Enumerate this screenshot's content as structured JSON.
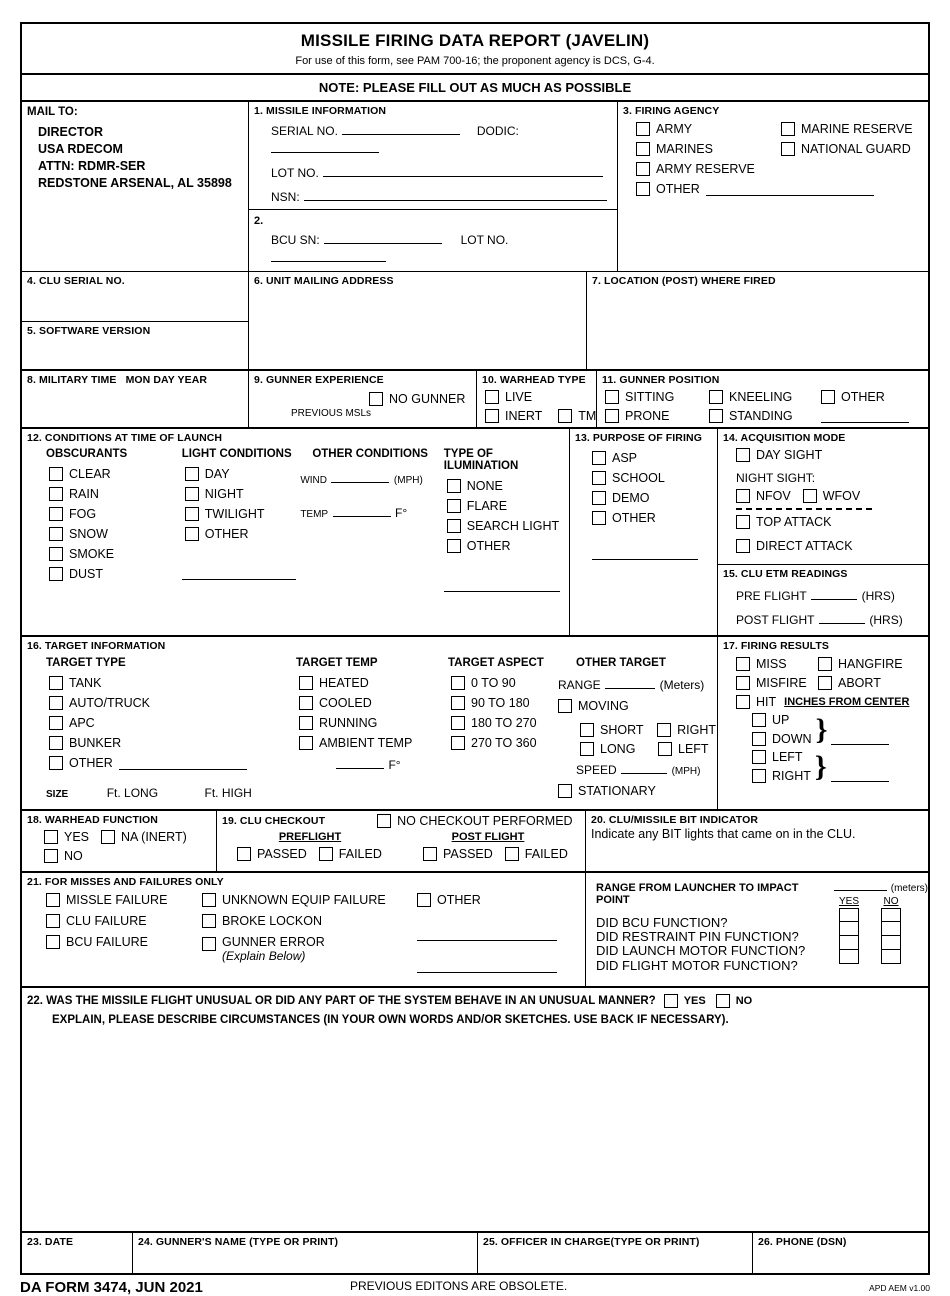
{
  "header": {
    "title": "MISSILE FIRING DATA REPORT (JAVELIN)",
    "subtitle": "For use of this form, see PAM 700-16; the proponent agency is DCS, G-4.",
    "note": "NOTE: PLEASE FILL OUT AS MUCH AS POSSIBLE"
  },
  "mail_to": {
    "label": "MAIL TO:",
    "lines": [
      "DIRECTOR",
      "USA RDECOM",
      "ATTN: RDMR-SER",
      "REDSTONE ARSENAL, AL 35898"
    ]
  },
  "s1": {
    "label": "1. MISSILE INFORMATION",
    "serial_no": "SERIAL NO.",
    "dodic": "DODIC:",
    "lot_no": "LOT NO.",
    "nsn": "NSN:"
  },
  "s2": {
    "num": "2.",
    "bcu_sn": "BCU SN:",
    "lot_no": "LOT NO."
  },
  "s3": {
    "label": "3. FIRING AGENCY",
    "options": [
      "ARMY",
      "MARINES",
      "ARMY RESERVE",
      "OTHER",
      "MARINE RESERVE",
      "NATIONAL GUARD"
    ]
  },
  "s4": {
    "label": "4. CLU SERIAL NO."
  },
  "s5": {
    "label": "5. SOFTWARE VERSION"
  },
  "s6": {
    "label": "6. UNIT MAILING ADDRESS"
  },
  "s7": {
    "label": "7. LOCATION (POST) WHERE FIRED"
  },
  "s8": {
    "label": "8. MILITARY TIME",
    "label2": "MON  DAY  YEAR"
  },
  "s9": {
    "label": "9. GUNNER EXPERIENCE",
    "no_gunner": "NO  GUNNER",
    "previous": "PREVIOUS MSLs"
  },
  "s10": {
    "label": "10. WARHEAD TYPE",
    "live": "LIVE",
    "inert": "INERT",
    "tm": "TM"
  },
  "s11": {
    "label": "11. GUNNER POSITION",
    "sitting": "SITTING",
    "kneeling": "KNEELING",
    "other": "OTHER",
    "prone": "PRONE",
    "standing": "STANDING"
  },
  "s12": {
    "label": "12. CONDITIONS AT TIME OF LAUNCH",
    "obscurants_hd": "OBSCURANTS",
    "obscurants": [
      "CLEAR",
      "RAIN",
      "FOG",
      "SNOW",
      "SMOKE",
      "DUST"
    ],
    "light_hd": "LIGHT CONDITIONS",
    "light": [
      "DAY",
      "NIGHT",
      "TWILIGHT",
      "OTHER"
    ],
    "other_hd": "OTHER CONDITIONS",
    "wind": "WIND",
    "mph": "(MPH)",
    "temp": "TEMP",
    "fdeg": "F°",
    "illum_hd": "TYPE OF ILUMINATION",
    "illum": [
      "NONE",
      "FLARE",
      "SEARCH LIGHT",
      "OTHER"
    ]
  },
  "s13": {
    "label": "13. PURPOSE OF FIRING",
    "options": [
      "ASP",
      "SCHOOL",
      "DEMO",
      "OTHER"
    ]
  },
  "s14": {
    "label": "14. ACQUISITION MODE",
    "day_sight": "DAY SIGHT",
    "night_sight": "NIGHT SIGHT:",
    "nfov": "NFOV",
    "wfov": "WFOV",
    "top_attack": "TOP ATTACK",
    "direct_attack": "DIRECT ATTACK"
  },
  "s15": {
    "label": "15. CLU ETM READINGS",
    "pre": "PRE FLIGHT",
    "post": "POST FLIGHT",
    "hrs": "(HRS)"
  },
  "s16": {
    "label": "16. TARGET INFORMATION",
    "type_hd": "TARGET TYPE",
    "types": [
      "TANK",
      "AUTO/TRUCK",
      "APC",
      "BUNKER",
      "OTHER"
    ],
    "temp_hd": "TARGET TEMP",
    "temps": [
      "HEATED",
      "COOLED",
      "RUNNING",
      "AMBIENT TEMP"
    ],
    "fdeg": "F°",
    "aspect_hd": "TARGET ASPECT",
    "aspects": [
      "0 TO 90",
      "90 TO 180",
      "180 TO 270",
      "270 TO 360"
    ],
    "other_hd": "OTHER TARGET",
    "range": "RANGE",
    "meters": "(Meters)",
    "moving": "MOVING",
    "short": "SHORT",
    "right": "RIGHT",
    "long": "LONG",
    "left": "LEFT",
    "speed": "SPEED",
    "mph": "(MPH)",
    "stationary": "STATIONARY",
    "size": "SIZE",
    "ft_long": "Ft. LONG",
    "ft_high": "Ft. HIGH"
  },
  "s17": {
    "label": "17. FIRING RESULTS",
    "miss": "MISS",
    "hangfire": "HANGFIRE",
    "misfire": "MISFIRE",
    "abort": "ABORT",
    "hit": "HIT",
    "inches": "INCHES FROM CENTER",
    "up": "UP",
    "down": "DOWN",
    "left": "LEFT",
    "right": "RIGHT"
  },
  "s18": {
    "label": "18. WARHEAD FUNCTION",
    "yes": "YES",
    "na": "NA (INERT)",
    "no": "NO"
  },
  "s19": {
    "label": "19. CLU CHECKOUT",
    "no_checkout": "NO CHECKOUT PERFORMED",
    "preflight": "PREFLIGHT",
    "postflight": "POST FLIGHT",
    "passed": "PASSED",
    "failed": "FAILED"
  },
  "s20": {
    "label": "20. CLU/MISSILE BIT INDICATOR",
    "text": "Indicate any BIT lights that came on in the CLU."
  },
  "s21": {
    "label": "21. FOR MISSES AND FAILURES ONLY",
    "col1": [
      "MISSLE FAILURE",
      "CLU FAILURE",
      "BCU FAILURE"
    ],
    "col2": [
      "UNKNOWN EQUIP FAILURE",
      "BROKE LOCKON",
      "GUNNER ERROR"
    ],
    "explain": "(Explain Below)",
    "other": "OTHER",
    "range_label": "RANGE FROM LAUNCHER TO IMPACT POINT",
    "meters": "(meters)",
    "yes": "YES",
    "no": "NO",
    "questions": [
      "DID BCU FUNCTION?",
      "DID RESTRAINT PIN FUNCTION?",
      "DID LAUNCH MOTOR FUNCTION?",
      "DID FLIGHT MOTOR FUNCTION?"
    ]
  },
  "s22": {
    "question": "22. WAS THE MISSILE FLIGHT UNUSUAL OR DID ANY PART OF THE SYSTEM BEHAVE IN AN UNUSUAL MANNER?",
    "yes": "YES",
    "no": "NO",
    "explain": "EXPLAIN, PLEASE DESCRIBE CIRCUMSTANCES (IN YOUR OWN WORDS AND/OR SKETCHES. USE BACK IF NECESSARY)."
  },
  "s23": {
    "label": "23. DATE"
  },
  "s24": {
    "label": "24. GUNNER'S NAME (TYPE OR PRINT)"
  },
  "s25": {
    "label": "25. OFFICER IN CHARGE(TYPE OR PRINT)"
  },
  "s26": {
    "label": "26. PHONE (DSN)"
  },
  "footer": {
    "form_id": "DA FORM 3474, JUN 2021",
    "obsolete": "PREVIOUS EDITONS ARE OBSOLETE.",
    "version": "APD AEM v1.00"
  }
}
